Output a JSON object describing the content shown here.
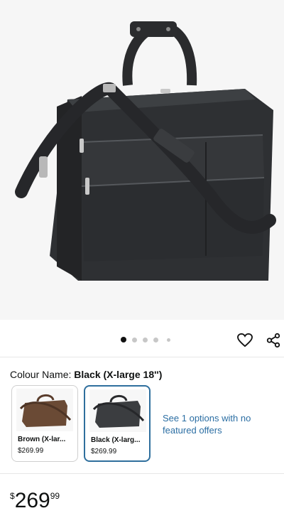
{
  "product": {
    "image_alt": "Black leather laptop briefcase with shoulder strap",
    "gallery": {
      "total": 5,
      "active_index": 0
    }
  },
  "actions": {
    "favorite_icon": "heart-outline-icon",
    "share_icon": "share-icon"
  },
  "variant": {
    "label": "Colour Name:",
    "selected_value": "Black (X-large 18'')",
    "options": [
      {
        "name": "Brown (X-lar...",
        "price": "$269.99",
        "color": "#6a4a35",
        "selected": false
      },
      {
        "name": "Black (X-larg...",
        "price": "$269.99",
        "color": "#3b3d40",
        "selected": true
      }
    ],
    "offers_link": "See 1 options with no featured offers"
  },
  "pricing": {
    "currency": "$",
    "whole": "269",
    "fraction": "99"
  },
  "colors": {
    "link": "#2b6ea3",
    "selected_border": "#2f6f9d"
  }
}
